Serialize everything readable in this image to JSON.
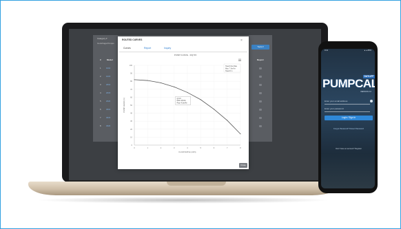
{
  "laptop_app": {
    "category_label": "Category ▾",
    "category_value": "Centrifugal Pumps",
    "table_headers": {
      "number": "#",
      "model": "Model",
      "report": "Report"
    },
    "rows": [
      {
        "num": "1",
        "model": "1010"
      },
      {
        "num": "2",
        "model": "1015"
      },
      {
        "num": "3",
        "model": "2010"
      },
      {
        "num": "4",
        "model": "2015"
      },
      {
        "num": "5",
        "model": "2020"
      },
      {
        "num": "6",
        "model": "3010"
      },
      {
        "num": "7",
        "model": "3015"
      },
      {
        "num": "8",
        "model": "3020"
      }
    ],
    "tools_button": "Tools ▾"
  },
  "modal": {
    "title": "ROUTED CURVES",
    "close_icon": "×",
    "tabs": [
      {
        "label": "Curves",
        "active": true
      },
      {
        "label": "Report",
        "active": false
      },
      {
        "label": "Inquiry",
        "active": false
      }
    ],
    "close_button": "Close"
  },
  "chart_data": {
    "type": "line",
    "title": "PUMP CURVE - 3IQ715",
    "xlabel": "FLOW RATE (m3/h)",
    "ylabel": "PUMP HEAD (m)",
    "xlim": [
      0,
      8
    ],
    "ylim": [
      0,
      100
    ],
    "x_ticks": [
      "0",
      "1",
      "2",
      "3",
      "4",
      "5",
      "6",
      "7",
      "8"
    ],
    "y_ticks": [
      "0",
      "10",
      "20",
      "30",
      "40",
      "50",
      "60",
      "70",
      "80",
      "90",
      "100"
    ],
    "series": [
      {
        "name": "",
        "x": [
          0,
          1,
          2,
          3,
          4,
          5,
          6,
          7,
          8
        ],
        "y": [
          82,
          81,
          78,
          73,
          66,
          57,
          45,
          31,
          14
        ]
      }
    ],
    "legend": [
      "Head Flow Rate",
      "Max: 7.6m³/hr",
      "Head 8 m"
    ],
    "tooltip": [
      "Q:3.0",
      "Flow: 26.0m",
      "Pow: 4.3m³/hr"
    ],
    "grid": true,
    "icon": "menu-icon"
  },
  "phone": {
    "status_time": "9:41",
    "status_icons": "▲ ● 83%",
    "logo_tag": "DAYLIFF",
    "logo": "PUMPCALC",
    "logo_sub": "VERSION 2.0",
    "username_placeholder": "Enter your email address",
    "password_placeholder": "Enter your password",
    "login_button": "Login / Sign In",
    "forgot_link": "Forgot Password? Reset Password",
    "register_text": "Don't have an account? Register"
  }
}
